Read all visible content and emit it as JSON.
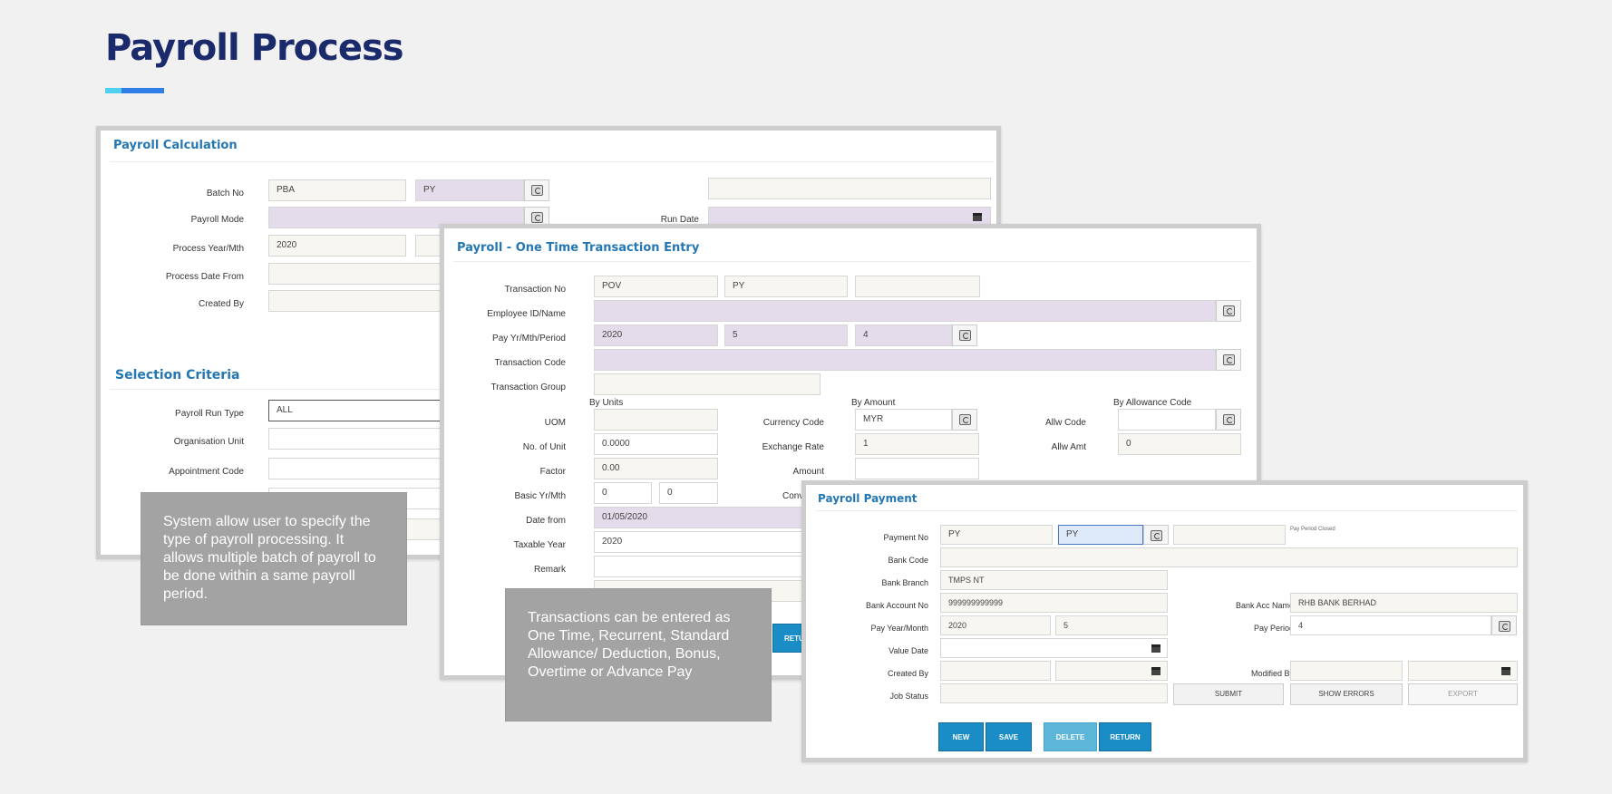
{
  "page": {
    "title": "Payroll Process"
  },
  "calc": {
    "title": "Payroll Calculation",
    "labels": {
      "batch_no": "Batch No",
      "payroll_mode": "Payroll Mode",
      "process_year": "Process Year/Mth",
      "process_date_from": "Process Date From",
      "created_by": "Created By",
      "run_date": "Run Date",
      "payroll_run_type": "Payroll Run Type",
      "org_unit": "Organisation Unit",
      "appointment_code": "Appointment Code"
    },
    "values": {
      "batch_no": "PBA",
      "batch_type": "PY",
      "process_year": "2020",
      "payroll_run_type": "ALL"
    },
    "selection_title": "Selection Criteria"
  },
  "ote": {
    "title": "Payroll - One Time Transaction Entry",
    "labels": {
      "transaction_no": "Transaction No",
      "employee": "Employee ID/Name",
      "pay_period": "Pay Yr/Mth/Period",
      "transaction_code": "Transaction Code",
      "transaction_group": "Transaction Group",
      "by_units": "By Units",
      "by_amount": "By Amount",
      "by_allowance": "By Allowance Code",
      "uom": "UOM",
      "no_of_unit": "No. of Unit",
      "factor": "Factor",
      "basic_yr_mth": "Basic Yr/Mth",
      "currency_code": "Currency Code",
      "exchange_rate": "Exchange Rate",
      "amount": "Amount",
      "conve": "Conve",
      "allw_code": "Allw Code",
      "allw_amt": "Allw Amt",
      "date_from": "Date from",
      "taxable_year": "Taxable Year",
      "remark": "Remark"
    },
    "values": {
      "transaction_no": "POV",
      "transaction_type": "PY",
      "pay_year": "2020",
      "pay_month": "5",
      "pay_period": "4",
      "no_of_unit": "0.0000",
      "factor": "0.00",
      "basic_yr": "0",
      "basic_mth": "0",
      "currency_code": "MYR",
      "exchange_rate": "1",
      "allw_amt": "0",
      "date_from": "01/05/2020",
      "taxable_year": "2020"
    },
    "return_partial": "RETU"
  },
  "payment": {
    "title": "Payroll Payment",
    "labels": {
      "payment_no": "Payment No",
      "bank_code": "Bank Code",
      "bank_branch": "Bank Branch",
      "bank_account_no": "Bank Account No",
      "pay_year_month": "Pay Year/Month",
      "value_date": "Value Date",
      "created_by": "Created By",
      "job_status": "Job Status",
      "bank_acc_name": "Bank Acc Name",
      "pay_period": "Pay Period",
      "modified_by": "Modified By"
    },
    "values": {
      "payment_no": "PY",
      "payment_type": "PY",
      "bank_branch": "TMPS NT",
      "bank_account_no": "999999999999",
      "pay_year": "2020",
      "pay_month": "5",
      "bank_acc_name": "RHB BANK BERHAD",
      "pay_period": "4",
      "pay_period_status": "Pay Period Closed"
    },
    "buttons": {
      "submit": "SUBMIT",
      "show_errors": "SHOW ERRORS",
      "export": "EXPORT",
      "new": "NEW",
      "save": "SAVE",
      "delete": "DELETE",
      "return": "RETURN"
    }
  },
  "notes": {
    "note1": "System allow user to specify the type of payroll processing. It allows multiple batch of payroll to be done within a same payroll period.",
    "note2": "Transactions can be entered as One Time, Recurrent, Standard Allowance/ Deduction, Bonus, Overtime or Advance Pay"
  },
  "colors": {
    "accent": "#2477b3",
    "title": "#1b2a6b",
    "button": "#1a8cc6"
  }
}
